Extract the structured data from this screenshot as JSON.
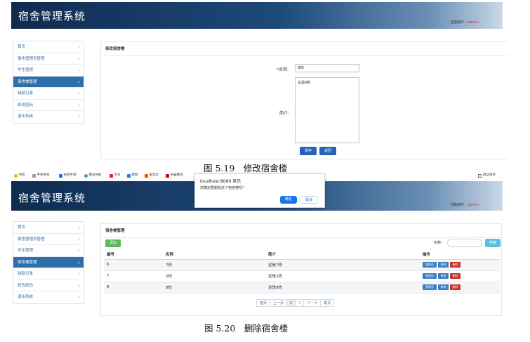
{
  "figure1": {
    "header": {
      "title": "宿舍管理系统",
      "user_label": "当前用户：",
      "user_name": "admin"
    },
    "sidebar": [
      {
        "label": "首页"
      },
      {
        "label": "宿舍管理员管理"
      },
      {
        "label": "学生管理"
      },
      {
        "label": "宿舍楼管理",
        "active": true
      },
      {
        "label": "缺勤记录"
      },
      {
        "label": "修改密码"
      },
      {
        "label": "退出系统"
      }
    ],
    "panel_title": "修改宿舍楼",
    "form": {
      "name_required_mark": "*",
      "name_label": "名称:",
      "name_value": "8栋",
      "intro_label": "简介:",
      "intro_value": "这是8栋"
    },
    "buttons": {
      "save": "保存",
      "back": "返回"
    },
    "caption": "图 5.19　修改宿舍楼"
  },
  "browser": {
    "bookmarks": [
      "书签",
      "手机书签",
      "谷歌手游",
      "网址导航",
      "京东",
      "携程",
      "爱淘宝",
      "天猫精选"
    ],
    "right_label": "阅读清单"
  },
  "dialog": {
    "title": "localhost:8080 显示",
    "message": "您确定要删除这个宿舍楼吗？",
    "ok": "确定",
    "cancel": "取消"
  },
  "figure2": {
    "header": {
      "title": "宿舍管理系统",
      "user_label": "当前用户：",
      "user_name": "admin"
    },
    "sidebar": [
      {
        "label": "首页"
      },
      {
        "label": "宿舍管理员管理"
      },
      {
        "label": "学生管理"
      },
      {
        "label": "宿舍楼管理",
        "active": true
      },
      {
        "label": "缺勤记录"
      },
      {
        "label": "修改密码"
      },
      {
        "label": "退出系统"
      }
    ],
    "panel_title": "宿舍楼管理",
    "add_button": "添加",
    "search": {
      "label": "名称:",
      "button": "搜索"
    },
    "table": {
      "columns": [
        "编号",
        "名称",
        "简介",
        "操作"
      ],
      "rows": [
        {
          "id": "6",
          "name": "7栋",
          "intro": "这是7栋"
        },
        {
          "id": "7",
          "name": "2栋",
          "intro": "这是2栋"
        },
        {
          "id": "8",
          "name": "8栋",
          "intro": "这是8栋"
        }
      ],
      "ops": {
        "view": "管理员",
        "edit": "修改",
        "del": "删除"
      }
    },
    "pager": {
      "first": "首页",
      "prev": "上一页",
      "p1": "1",
      "p2": "2",
      "next": "下一页",
      "last": "尾页"
    },
    "caption": "图 5.20　删除宿舍楼"
  }
}
